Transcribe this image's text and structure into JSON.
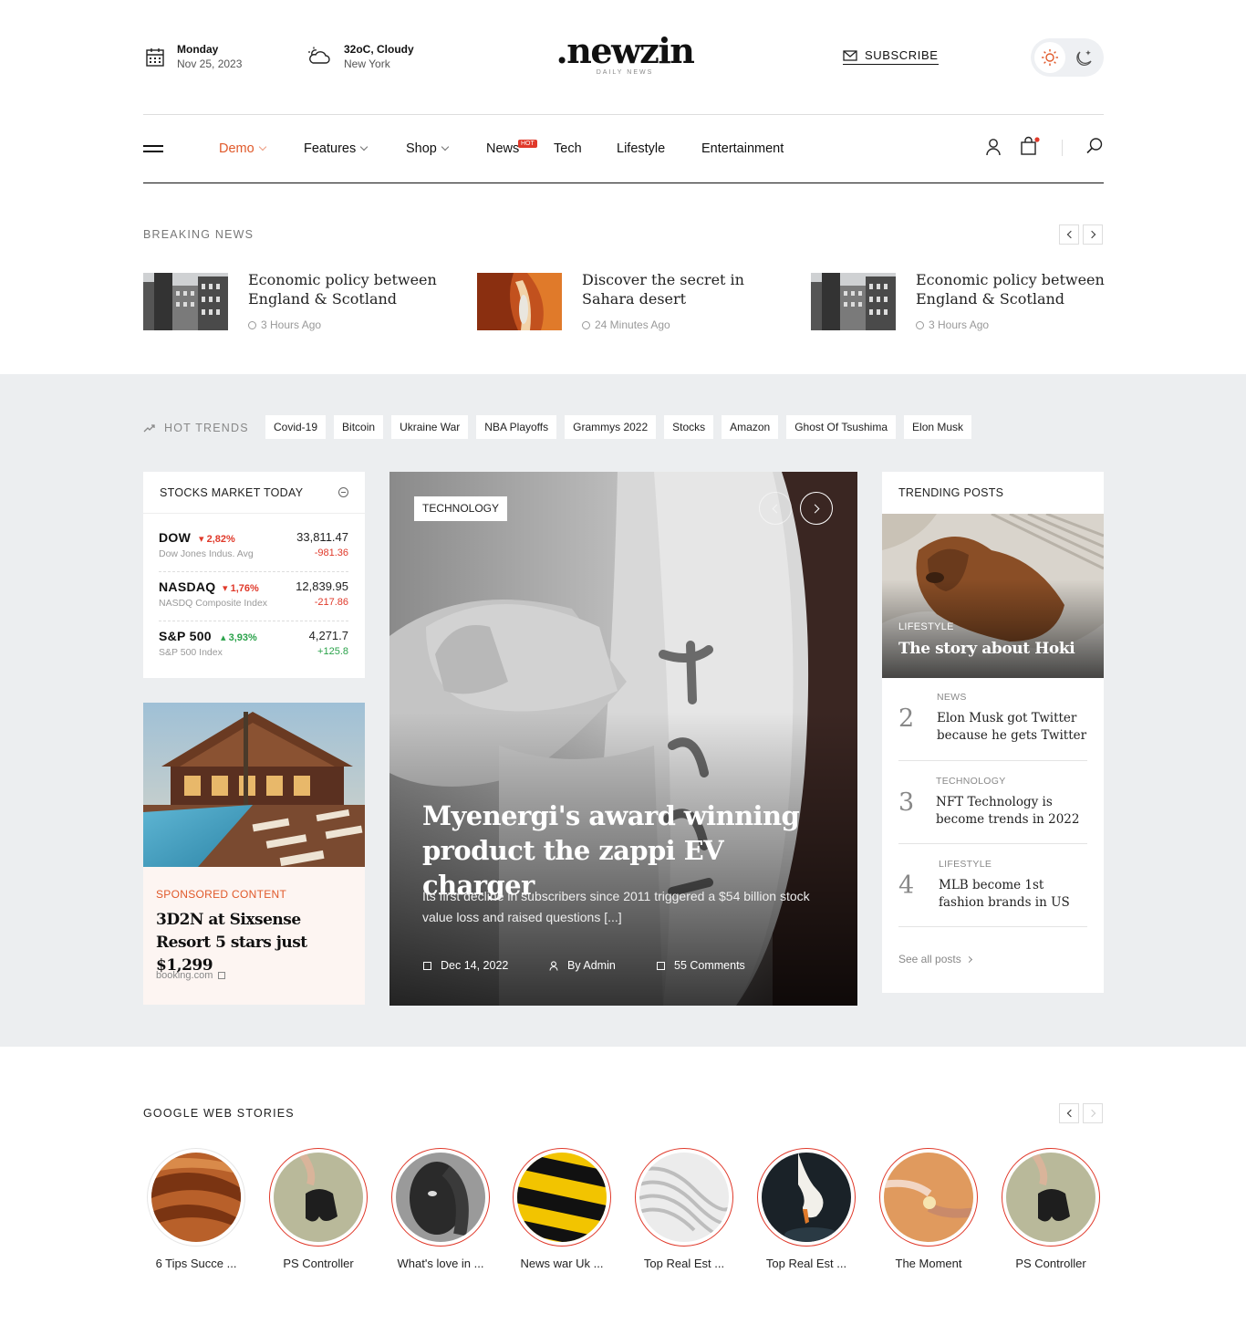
{
  "header": {
    "date_day": "Monday",
    "date_full": "Nov 25, 2023",
    "weather_temp": "32oC, Cloudy",
    "weather_city": "New York",
    "logo": ".newzin",
    "logo_tagline": "DAILY NEWS",
    "subscribe": "SUBSCRIBE"
  },
  "nav": {
    "items": [
      {
        "label": "Demo"
      },
      {
        "label": "Features"
      },
      {
        "label": "Shop"
      },
      {
        "label": "News",
        "badge": "HOT"
      },
      {
        "label": "Tech"
      },
      {
        "label": "Lifestyle"
      },
      {
        "label": "Entertainment"
      }
    ]
  },
  "breaking": {
    "title": "BREAKING NEWS",
    "items": [
      {
        "title": "Economic policy between England & Scotland",
        "time": "3 Hours Ago"
      },
      {
        "title": "Discover the secret in Sahara desert",
        "time": "24 Minutes Ago"
      },
      {
        "title": "Economic policy between England & Scotland",
        "time": "3 Hours Ago"
      }
    ]
  },
  "trends": {
    "label": "HOT TRENDS",
    "chips": [
      "Covid-19",
      "Bitcoin",
      "Ukraine War",
      "NBA Playoffs",
      "Grammys 2022",
      "Stocks",
      "Amazon",
      "Ghost Of Tsushima",
      "Elon Musk"
    ]
  },
  "stocks": {
    "title": "STOCKS MARKET TODAY",
    "rows": [
      {
        "name": "DOW",
        "pct": "2,82%",
        "direction": "down",
        "sub": "Dow Jones Indus. Avg",
        "value": "33,811.47",
        "change": "-981.36"
      },
      {
        "name": "NASDAQ",
        "pct": "1,76%",
        "direction": "down",
        "sub": "NASDQ Composite Index",
        "value": "12,839.95",
        "change": "-217.86"
      },
      {
        "name": "S&P 500",
        "pct": "3,93%",
        "direction": "up",
        "sub": "S&P 500 Index",
        "value": "4,271.7",
        "change": "+125.8"
      }
    ]
  },
  "sponsored": {
    "label": "SPONSORED CONTENT",
    "title": "3D2N at Sixsense Resort 5 stars just $1,299",
    "source": "booking.com"
  },
  "hero": {
    "category": "TECHNOLOGY",
    "headline": "Myenergi's award winning product the zappi EV charger",
    "excerpt": "Its first decline in subscribers since 2011 triggered a $54 billion stock value loss and raised questions [...]",
    "date": "Dec 14, 2022",
    "author": "By Admin",
    "comments": "55 Comments"
  },
  "trending": {
    "title": "TRENDING POSTS",
    "feature": {
      "category": "LIFESTYLE",
      "title": "The story about Hoki"
    },
    "items": [
      {
        "num": "2",
        "category": "NEWS",
        "title": "Elon Musk got Twitter because he gets Twitter"
      },
      {
        "num": "3",
        "category": "TECHNOLOGY",
        "title": "NFT Technology is become trends in 2022"
      },
      {
        "num": "4",
        "category": "LIFESTYLE",
        "title": "MLB become 1st fashion brands in US"
      }
    ],
    "see_all": "See all posts"
  },
  "stories": {
    "title": "GOOGLE WEB STORIES",
    "items": [
      {
        "caption": "6 Tips Succe ..."
      },
      {
        "caption": "PS Controller"
      },
      {
        "caption": "What's love in ..."
      },
      {
        "caption": "News war Uk ..."
      },
      {
        "caption": "Top Real Est ..."
      },
      {
        "caption": "Top Real Est ..."
      },
      {
        "caption": "The Moment"
      },
      {
        "caption": "PS Controller"
      }
    ]
  },
  "colors": {
    "accent": "#e0592a",
    "hot_badge": "#e0392a",
    "stock_down": "#e0392a",
    "stock_up": "#2aa24a",
    "band_bg": "#eceef0"
  },
  "icons": [
    "calendar-icon",
    "cloud-sun-icon",
    "mail-icon",
    "sun-icon",
    "moon-icon",
    "menu-icon",
    "user-icon",
    "cart-icon",
    "search-icon",
    "clock-icon",
    "trend-icon"
  ]
}
